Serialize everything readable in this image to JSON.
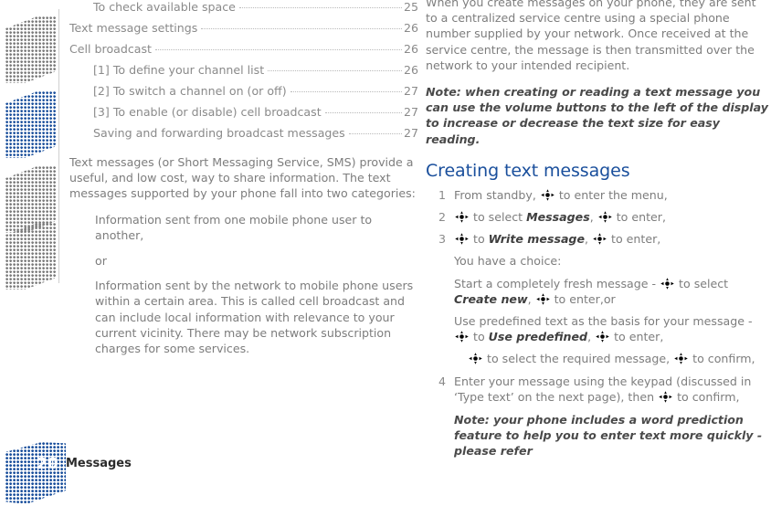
{
  "document": {
    "footer": {
      "page_number": "20",
      "section_title": "Messages"
    },
    "icons": {
      "nav_key": "navigation-key-icon"
    },
    "colors": {
      "accent_blue": "#1a4f9c",
      "body_text": "#7d7d7d",
      "emphasis_text": "#3f3f3f"
    }
  },
  "left_column": {
    "toc": [
      {
        "label": "To check available space",
        "page": "25",
        "level": 2
      },
      {
        "label": "Text message settings",
        "page": "26",
        "level": 1
      },
      {
        "label": "Cell broadcast",
        "page": "26",
        "level": 1
      },
      {
        "label": "[1] To define your channel list",
        "page": "26",
        "level": 2
      },
      {
        "label": "[2] To switch a channel on (or off)",
        "page": "27",
        "level": 2
      },
      {
        "label": "[3] To enable (or disable) cell broadcast",
        "page": "27",
        "level": 2
      },
      {
        "label": "Saving and forwarding broadcast messages",
        "page": "27",
        "level": 2
      }
    ],
    "intro": "Text messages (or Short Messaging Service, SMS) provide a useful, and low cost, way to share information. The text messages supported by your phone fall into two categories:",
    "bullets": [
      "Information sent from one mobile phone user to another,",
      "or",
      "Information sent by the network to mobile phone users within a certain area. This is called cell broadcast and can include local information with relevance to your current vicinity. There may be network subscription charges for some services."
    ]
  },
  "right_column": {
    "intro": "When you create messages on your phone, they are sent to a centralized service centre using a special phone number supplied by your network. Once received at the service centre, the message is then transmitted over the network to your intended recipient.",
    "note_top": "Note: when creating or reading a text message you can use the volume buttons to the left of the display to increase or decrease the text size for easy reading.",
    "heading": "Creating text messages",
    "steps": [
      {
        "number": "1",
        "parts": [
          {
            "type": "text",
            "value": "From standby, "
          },
          {
            "type": "icon",
            "value": "navigation-key-icon"
          },
          {
            "type": "text",
            "value": " to enter the menu,"
          }
        ]
      },
      {
        "number": "2",
        "parts": [
          {
            "type": "icon",
            "value": "navigation-key-icon"
          },
          {
            "type": "text",
            "value": " to select "
          },
          {
            "type": "emphasis",
            "value": "Messages"
          },
          {
            "type": "text",
            "value": ", "
          },
          {
            "type": "icon",
            "value": "navigation-key-icon"
          },
          {
            "type": "text",
            "value": " to enter,"
          }
        ]
      },
      {
        "number": "3",
        "parts": [
          {
            "type": "icon",
            "value": "navigation-key-icon"
          },
          {
            "type": "text",
            "value": " to "
          },
          {
            "type": "emphasis",
            "value": "Write message"
          },
          {
            "type": "text",
            "value": ",  "
          },
          {
            "type": "icon",
            "value": "navigation-key-icon"
          },
          {
            "type": "text",
            "value": " to enter,"
          }
        ]
      }
    ],
    "choice_intro": "You have a choice:",
    "choices": [
      {
        "parts": [
          {
            "type": "text",
            "value": "Start a completely fresh message - "
          },
          {
            "type": "icon",
            "value": "navigation-key-icon"
          },
          {
            "type": "text",
            "value": " to select "
          },
          {
            "type": "emphasis",
            "value": "Create new"
          },
          {
            "type": "text",
            "value": ",  "
          },
          {
            "type": "icon",
            "value": "navigation-key-icon"
          },
          {
            "type": "text",
            "value": " to enter,or"
          }
        ]
      },
      {
        "parts": [
          {
            "type": "text",
            "value": "Use predefined text as the basis for your message - "
          },
          {
            "type": "icon",
            "value": "navigation-key-icon"
          },
          {
            "type": "text",
            "value": " to "
          },
          {
            "type": "emphasis",
            "value": "Use predefined"
          },
          {
            "type": "text",
            "value": ", "
          },
          {
            "type": "icon",
            "value": "navigation-key-icon"
          },
          {
            "type": "text",
            "value": " to enter,"
          }
        ]
      }
    ],
    "choice_sub": {
      "parts": [
        {
          "type": "icon",
          "value": "navigation-key-icon"
        },
        {
          "type": "text",
          "value": " to select the required message, "
        },
        {
          "type": "icon",
          "value": "navigation-key-icon"
        },
        {
          "type": "text",
          "value": " to confirm,"
        }
      ]
    },
    "step4": {
      "number": "4",
      "parts": [
        {
          "type": "text",
          "value": "Enter your message using the keypad (discussed in ‘Type text’ on the next page), then "
        },
        {
          "type": "icon",
          "value": "navigation-key-icon"
        },
        {
          "type": "text",
          "value": " to confirm,"
        }
      ]
    },
    "note_bottom": "Note: your phone includes a word prediction feature to help you to enter text more quickly - please refer"
  }
}
